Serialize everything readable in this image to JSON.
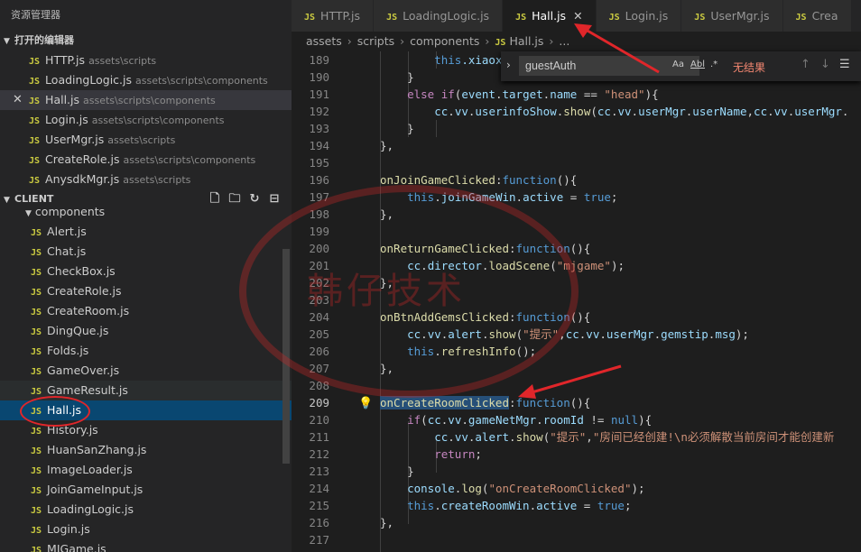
{
  "sidebar": {
    "title": "资源管理器",
    "open_editors": {
      "label": "打开的编辑器",
      "items": [
        {
          "name": "HTTP.js",
          "path": "assets\\scripts"
        },
        {
          "name": "LoadingLogic.js",
          "path": "assets\\scripts\\components"
        },
        {
          "name": "Hall.js",
          "path": "assets\\scripts\\components"
        },
        {
          "name": "Login.js",
          "path": "assets\\scripts\\components"
        },
        {
          "name": "UserMgr.js",
          "path": "assets\\scripts"
        },
        {
          "name": "CreateRole.js",
          "path": "assets\\scripts\\components"
        },
        {
          "name": "AnysdkMgr.js",
          "path": "assets\\scripts"
        }
      ]
    },
    "project": {
      "label": "CLIENT",
      "folder": "components",
      "files": [
        "Alert.js",
        "Chat.js",
        "CheckBox.js",
        "CreateRole.js",
        "CreateRoom.js",
        "DingQue.js",
        "Folds.js",
        "GameOver.js",
        "GameResult.js",
        "Hall.js",
        "History.js",
        "HuanSanZhang.js",
        "ImageLoader.js",
        "JoinGameInput.js",
        "LoadingLogic.js",
        "Login.js",
        "MJGame.js"
      ],
      "actions": [
        "new-file-icon",
        "new-folder-icon",
        "refresh-icon",
        "collapse-icon"
      ]
    },
    "js_badge": "JS"
  },
  "tabs": [
    "HTTP.js",
    "LoadingLogic.js",
    "Hall.js",
    "Login.js",
    "UserMgr.js",
    "Crea"
  ],
  "active_tab": "Hall.js",
  "breadcrumb": [
    "assets",
    "scripts",
    "components",
    "Hall.js",
    "..."
  ],
  "find": {
    "value": "guestAuth",
    "options": [
      "Aa",
      "Abl",
      ".*"
    ],
    "result": "无结果"
  },
  "watermark": "韩仔技术",
  "code": {
    "current_line": "209",
    "lines": [
      {
        "n": "189"
      },
      {
        "n": "190"
      },
      {
        "n": "191"
      },
      {
        "n": "192"
      },
      {
        "n": "193"
      },
      {
        "n": "194"
      },
      {
        "n": "195"
      },
      {
        "n": "196"
      },
      {
        "n": "197"
      },
      {
        "n": "198"
      },
      {
        "n": "199"
      },
      {
        "n": "200"
      },
      {
        "n": "201"
      },
      {
        "n": "202"
      },
      {
        "n": "203"
      },
      {
        "n": "204"
      },
      {
        "n": "205"
      },
      {
        "n": "206"
      },
      {
        "n": "207"
      },
      {
        "n": "208"
      },
      {
        "n": "209"
      },
      {
        "n": "210"
      },
      {
        "n": "211"
      },
      {
        "n": "212"
      },
      {
        "n": "213"
      },
      {
        "n": "214"
      },
      {
        "n": "215"
      },
      {
        "n": "216"
      },
      {
        "n": "217"
      }
    ]
  }
}
